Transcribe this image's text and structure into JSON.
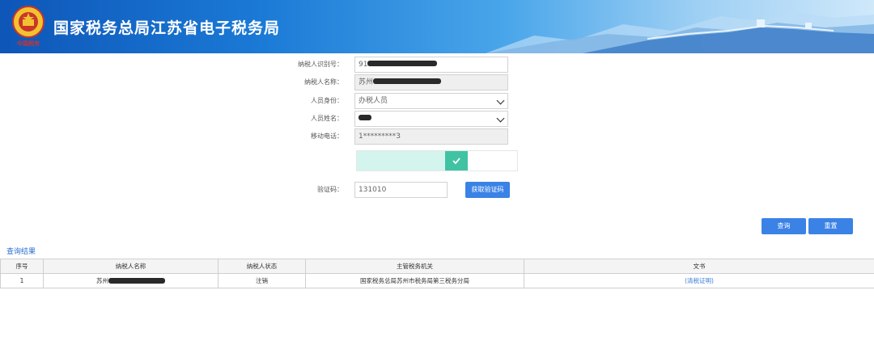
{
  "header": {
    "title": "国家税务总局江苏省电子税务局",
    "emblem_text": "中国税务",
    "emblem_icon": "tax-emblem-icon",
    "background_colors": [
      "#0e56b8",
      "#4aa6ea",
      "#cfe8fa"
    ]
  },
  "form": {
    "taxpayer_id": {
      "label": "纳税人识别号：",
      "value_prefix": "91"
    },
    "taxpayer_name": {
      "label": "纳税人名称：",
      "value_prefix": "苏州"
    },
    "person_identity": {
      "label": "人员身份：",
      "selected": "办税人员"
    },
    "person_name": {
      "label": "人员姓名："
    },
    "mobile": {
      "label": "移动电话：",
      "value": "1*********3"
    },
    "slider": {
      "state": "verified",
      "icon": "check-icon",
      "progress": 0.69
    },
    "verification_code": {
      "label": "验证码：",
      "value": "131010"
    },
    "get_code_button": "获取验证码"
  },
  "actions": {
    "query": "查询",
    "reset": "重置"
  },
  "results": {
    "section_title": "查询结果",
    "columns": [
      "序号",
      "纳税人名称",
      "纳税人状态",
      "主管税务机关",
      "文书"
    ],
    "rows": [
      {
        "index": "1",
        "name_prefix": "苏州",
        "status": "注销",
        "authority": "国家税务总局苏州市税务局第三税务分局",
        "document": "(清税证明)"
      }
    ]
  },
  "colors": {
    "primary": "#3b82e6",
    "slider_fill": "#d3f5ee",
    "slider_handle": "#40c3a2",
    "link": "#3b7dd8"
  }
}
